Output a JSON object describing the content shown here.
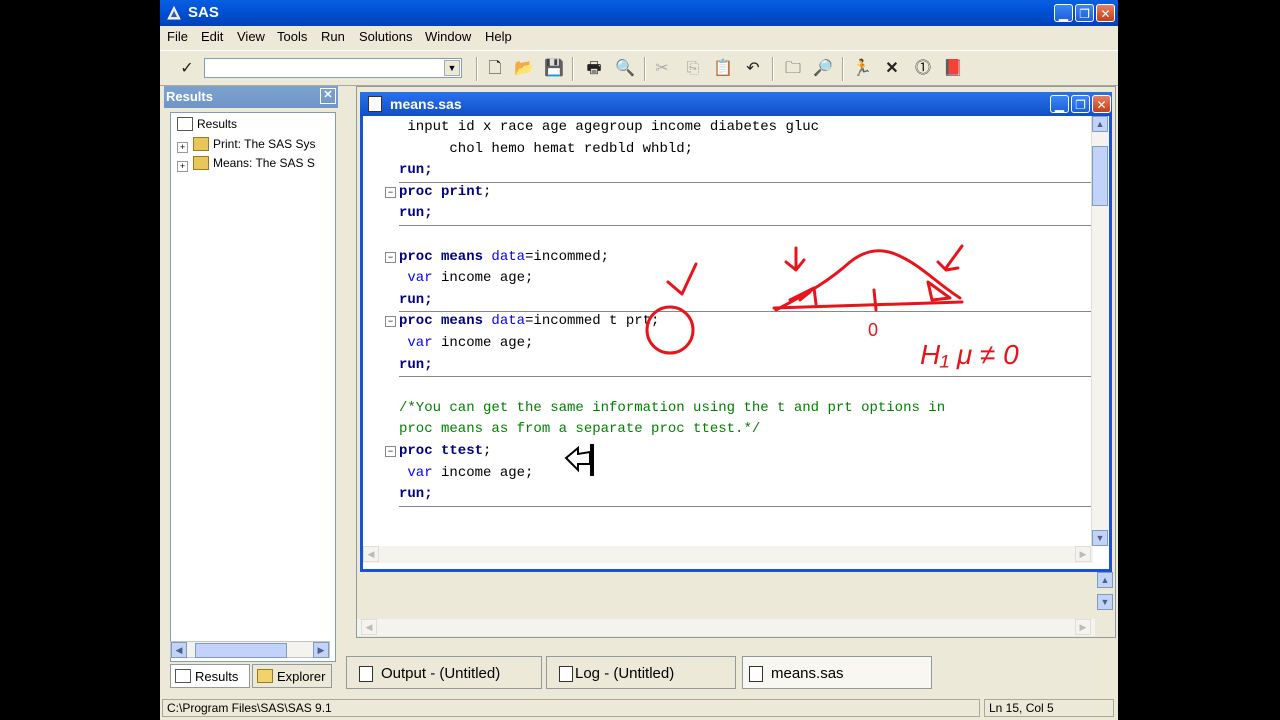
{
  "app": {
    "title": "SAS"
  },
  "menu": [
    "File",
    "Edit",
    "View",
    "Tools",
    "Run",
    "Solutions",
    "Window",
    "Help"
  ],
  "toolbar": {
    "command_value": ""
  },
  "results": {
    "header": "Results",
    "root": "Results",
    "items": [
      "Print:  The SAS Sys",
      "Means:  The SAS S"
    ],
    "tabs": [
      "Results",
      "Explorer"
    ]
  },
  "editor": {
    "title": "means.sas",
    "lines": [
      {
        "segments": [
          {
            "t": " input id x race age agegroup income diabetes gluc",
            "c": ""
          }
        ]
      },
      {
        "segments": [
          {
            "t": "      chol hemo hemat redbld whbld;",
            "c": ""
          }
        ]
      },
      {
        "segments": [
          {
            "t": "run;",
            "c": "kw"
          }
        ]
      },
      {
        "segments": [
          {
            "t": "proc print",
            "c": "kw"
          },
          {
            "t": ";",
            "c": ""
          }
        ]
      },
      {
        "segments": [
          {
            "t": "run;",
            "c": "kw"
          }
        ]
      },
      {
        "segments": []
      },
      {
        "segments": [
          {
            "t": "proc means",
            "c": "kw"
          },
          {
            "t": " ",
            "c": ""
          },
          {
            "t": "data",
            "c": "kw2"
          },
          {
            "t": "=incommed;",
            "c": ""
          }
        ]
      },
      {
        "segments": [
          {
            "t": " var",
            "c": "kw2"
          },
          {
            "t": " income age;",
            "c": ""
          }
        ]
      },
      {
        "segments": [
          {
            "t": "run;",
            "c": "kw"
          }
        ]
      },
      {
        "segments": [
          {
            "t": "proc means",
            "c": "kw"
          },
          {
            "t": " ",
            "c": ""
          },
          {
            "t": "data",
            "c": "kw2"
          },
          {
            "t": "=incommed t prt;",
            "c": ""
          }
        ]
      },
      {
        "segments": [
          {
            "t": " var",
            "c": "kw2"
          },
          {
            "t": " income age;",
            "c": ""
          }
        ]
      },
      {
        "segments": [
          {
            "t": "run;",
            "c": "kw"
          }
        ]
      },
      {
        "segments": []
      },
      {
        "segments": [
          {
            "t": "/*You can get the same information using the t and prt options in",
            "c": "cm"
          }
        ]
      },
      {
        "segments": [
          {
            "t": "proc means as from a separate proc ttest.*/",
            "c": "cm"
          }
        ]
      },
      {
        "segments": [
          {
            "t": "proc ttest",
            "c": "kw"
          },
          {
            "t": ";",
            "c": ""
          }
        ]
      },
      {
        "segments": [
          {
            "t": " var",
            "c": "kw2"
          },
          {
            "t": " income age;",
            "c": ""
          }
        ]
      },
      {
        "segments": [
          {
            "t": "run;",
            "c": "kw"
          }
        ]
      }
    ]
  },
  "bottom_tabs": [
    {
      "label": "Output - (Untitled)",
      "active": false
    },
    {
      "label": "Log - (Untitled)",
      "active": false
    },
    {
      "label": "means.sas",
      "active": true
    }
  ],
  "status": {
    "path": "C:\\Program Files\\SAS\\SAS 9.1",
    "position": "Ln 15, Col 5"
  },
  "annotation": {
    "color": "#e8141c",
    "text": "H₁ μ ≠ 0",
    "zero_label": "0"
  }
}
